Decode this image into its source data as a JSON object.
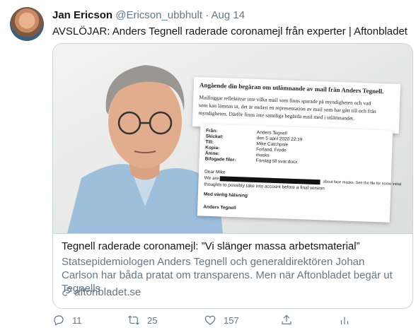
{
  "tweet": {
    "name": "Jan Ericson",
    "handle": "@Ericson_ubbhult",
    "separator": "·",
    "date": "Aug 14",
    "text": "AVSLÖJAR: Anders Tegnell raderade coronamejl från experter | Aftonbladet"
  },
  "card": {
    "title": "Tegnell raderade coronamejl: ”Vi slänger massa arbetsmaterial”",
    "description": "Statsepidemiologen Anders Tegnell och generaldirektören Johan Carlson har båda pratat om transparens. Men när Aftonbladet begär ut Tegnells ...",
    "domain": "aftonbladet.se",
    "image_doc": {
      "heading": "Angående din begäran om utlämnande av mail från Anders Tegnell.",
      "line1": "Mailloggar reflekterar inte vilka mail som finns sparade på myndigheten och vad",
      "line2": "som kan lämnas ut, det är endast en representation av mail som har gått till och från",
      "line3": "myndigheten. Därför finns inte samtliga begärda mail med i utlämnandet.",
      "fields": [
        {
          "label": "Från:",
          "value": "Anders Tegnell"
        },
        {
          "label": "Skickat:",
          "value": "den 5 april 2020 22:19"
        },
        {
          "label": "Till:",
          "value": "Mike Catchpole"
        },
        {
          "label": "Kopia:",
          "value": "Forland, Frode"
        },
        {
          "label": "Ämne:",
          "value": "masks"
        },
        {
          "label": "Bifogade filer:",
          "value": "Förslag till svar.docx"
        }
      ],
      "greeting": "Dear Mike",
      "body_start": "We are",
      "body_mid": "about face masks. See the file for some initial",
      "body2": "thoughts to possibly take into account before a final version",
      "closing": "Med vänlig hälsning",
      "signature": "Anders Tegnell"
    }
  },
  "actions": {
    "reply_count": "11",
    "retweet_count": "25",
    "like_count": "157"
  },
  "colors": {
    "text": "#14171a",
    "secondary": "#657786",
    "border": "#ccd6dd"
  }
}
